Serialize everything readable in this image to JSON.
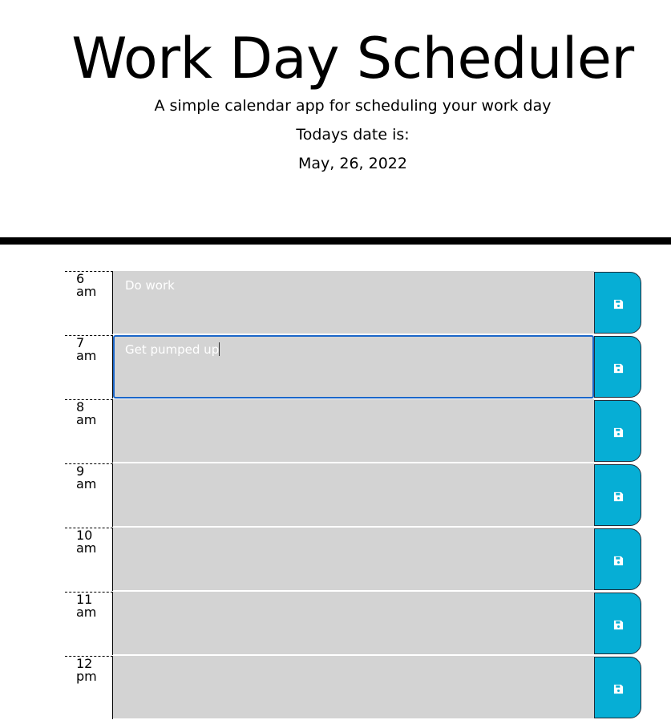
{
  "header": {
    "title": "Work Day Scheduler",
    "subtitle": "A simple calendar app for scheduling your work day",
    "date_label": "Todays date is:",
    "date_value": "May, 26, 2022"
  },
  "colors": {
    "slot_background": "#d3d3d3",
    "save_button": "#06aed5",
    "focus_outline": "#1a66c9",
    "divider": "#000000"
  },
  "schedule": {
    "rows": [
      {
        "hour": "6",
        "period": "am",
        "text": "Do work",
        "focused": false,
        "save_icon": "floppy-disk-icon"
      },
      {
        "hour": "7",
        "period": "am",
        "text": "Get pumped up",
        "focused": true,
        "save_icon": "floppy-disk-icon"
      },
      {
        "hour": "8",
        "period": "am",
        "text": "",
        "focused": false,
        "save_icon": "floppy-disk-icon"
      },
      {
        "hour": "9",
        "period": "am",
        "text": "",
        "focused": false,
        "save_icon": "floppy-disk-icon"
      },
      {
        "hour": "10",
        "period": "am",
        "text": "",
        "focused": false,
        "save_icon": "floppy-disk-icon"
      },
      {
        "hour": "11",
        "period": "am",
        "text": "",
        "focused": false,
        "save_icon": "floppy-disk-icon"
      },
      {
        "hour": "12",
        "period": "pm",
        "text": "",
        "focused": false,
        "save_icon": "floppy-disk-icon"
      }
    ]
  }
}
